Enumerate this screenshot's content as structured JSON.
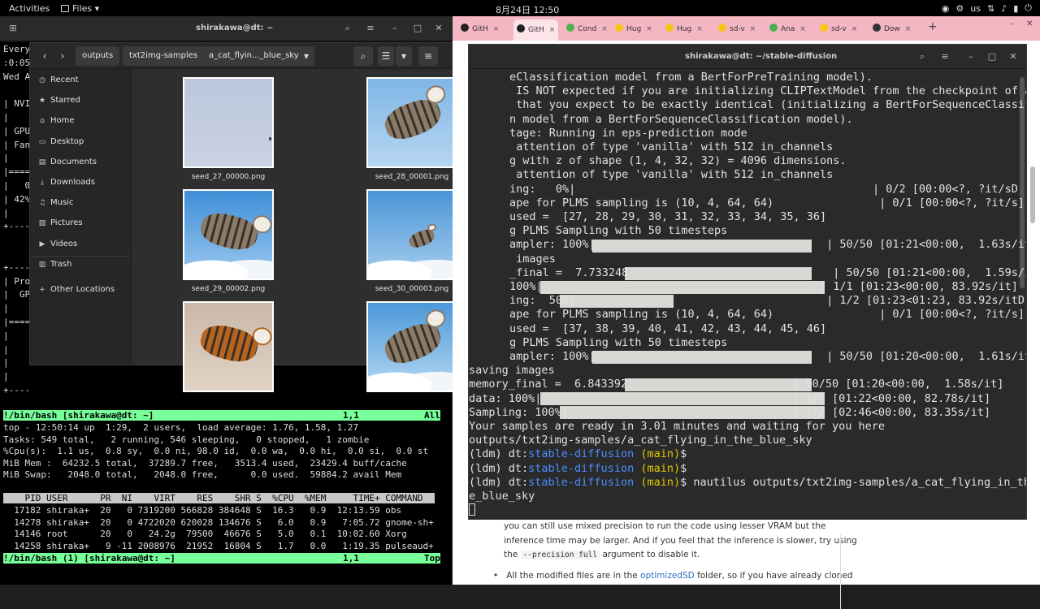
{
  "topbar": {
    "activities": "Activities",
    "files_menu": "Files ▾",
    "clock": "8月24日  12:50",
    "keyboard": "us",
    "tray_icons": [
      "chrome-icon",
      "settings-icon",
      "keyboard-layout",
      "network-icon",
      "volume-icon",
      "battery-icon",
      "power-icon"
    ]
  },
  "left_terminal": {
    "title": "shirakawa@dt: ~",
    "lines": [
      "Every",
      ":0:05",
      "Wed A",
      "",
      "| NVI",
      "|",
      "| GPU",
      "| Fan",
      "|",
      "|====",
      "|   0",
      "| 42%",
      "|",
      "+----",
      "",
      "",
      "+----",
      "| Pro",
      "|  GP",
      "|",
      "|====",
      "|",
      "|",
      "|",
      "|",
      "+----"
    ],
    "vim_status_top": {
      "left": "!/bin/bash [shirakawa@dt: ~]",
      "pos": "1,1",
      "scroll": "All"
    },
    "top_output": [
      "top - 12:50:14 up  1:29,  2 users,  load average: 1.76, 1.58, 1.27",
      "Tasks: 549 total,   2 running, 546 sleeping,   0 stopped,   1 zombie",
      "%Cpu(s):  1.1 us,  0.8 sy,  0.0 ni, 98.0 id,  0.0 wa,  0.0 hi,  0.0 si,  0.0 st",
      "MiB Mem :  64232.5 total,  37289.7 free,   3513.4 used,  23429.4 buff/cache",
      "MiB Swap:   2048.0 total,   2048.0 free,      0.0 used.  59884.2 avail Mem"
    ],
    "process_header": "    PID USER      PR  NI    VIRT    RES    SHR S  %CPU  %MEM     TIME+ COMMAND",
    "processes": [
      "  17182 shiraka+  20   0 7319200 566828 384648 S  16.3   0.9  12:13.59 obs",
      "  14278 shiraka+  20   0 4722020 620028 134676 S   6.0   0.9   7:05.72 gnome-sh+",
      "  14146 root      20   0   24.2g  79500  46676 S   5.0   0.1  10:02.60 Xorg",
      "  14258 shiraka+   9 -11 2008976  21952  16804 S   1.7   0.0   1:19.35 pulseaud+"
    ],
    "vim_status_bottom": {
      "left": "!/bin/bash (1) [shirakawa@dt: ~]",
      "pos": "1,1",
      "scroll": "Top"
    }
  },
  "file_manager": {
    "breadcrumbs": [
      "outputs",
      "txt2img-samples",
      "a_cat_flyin..._blue_sky"
    ],
    "sidebar": [
      "Recent",
      "Starred",
      "Home",
      "Desktop",
      "Documents",
      "Downloads",
      "Music",
      "Pictures",
      "Videos",
      "Trash",
      "Other Locations"
    ],
    "sidebar_icons": [
      "clock-icon",
      "star-icon",
      "home-icon",
      "desktop-icon",
      "document-icon",
      "download-icon",
      "music-icon",
      "pictures-icon",
      "videos-icon",
      "trash-icon",
      "plus-icon"
    ],
    "files": [
      "seed_27_00000.png",
      "seed_28_00001.png",
      "seed_29_00002.png",
      "seed_30_00003.png",
      "",
      ""
    ]
  },
  "browser": {
    "tabs": [
      "GitH",
      "GitH",
      "Cond",
      "Hug",
      "Hug",
      "sd-v",
      "Ana",
      "sd-v",
      "Dow"
    ],
    "tab_colors": [
      "#222222",
      "#222222",
      "#4caf50",
      "#f5c518",
      "#f5c518",
      "#f5c518",
      "#4caf50",
      "#f5c518",
      "#333333"
    ],
    "doc_line1": "you can still use mixed precision to run the code using lesser VRAM but the",
    "doc_line2": "inference time may be larger. And if you feel that the inference is slower, try using",
    "doc_line3_pre": "the",
    "doc_code": "--precision full",
    "doc_line3_post": "argument to disable it.",
    "doc_bullet_pre": "All the modified files are in the",
    "doc_link": "optimizedSD",
    "doc_bullet_post": "folder, so if you have already cloned"
  },
  "right_terminal": {
    "title": "shirakawa@dt: ~/stable-diffusion",
    "lines": [
      "eClassification model from a BertForPreTraining model).",
      " IS NOT expected if you are initializing CLIPTextModel from the checkpoint of a",
      " that you expect to be exactly identical (initializing a BertForSequenceClassif",
      "n model from a BertForSequenceClassification model).",
      "tage: Running in eps-prediction mode",
      " attention of type 'vanilla' with 512 in_channels",
      "g with z of shape (1, 4, 32, 32) = 4096 dimensions.",
      " attention of type 'vanilla' with 512 in_channels",
      "ing:   0%|                                             | 0/2 [00:00<?, ?it/sD",
      "ape for PLMS sampling is (10, 4, 64, 64)                | 0/1 [00:00<?, ?it/s]",
      "used =  [27, 28, 29, 30, 31, 32, 33, 34, 35, 36]",
      "g PLMS Sampling with 50 timesteps",
      "ampler: 100%|                                   | 50/50 [01:21<00:00,  1.63s/it]",
      " images",
      "_final =  7.733248                               | 50/50 [01:21<00:00,  1.59s/it]",
      "100%|                                          | 1/1 [01:23<00:00, 83.92s/it]",
      "ing:  50%|                                      | 1/2 [01:23<01:23, 83.92s/itD",
      "ape for PLMS sampling is (10, 4, 64, 64)                | 0/1 [00:00<?, ?it/s]",
      "used =  [37, 38, 39, 40, 41, 42, 43, 44, 45, 46]",
      "g PLMS Sampling with 50 timesteps",
      "ampler: 100%|                                   | 50/50 [01:20<00:00,  1.61s/it]",
      "saving images",
      "memory_final =  6.843392                         | 50/50 [01:20<00:00,  1.58s/it]",
      "data: 100%|                                      | 1/1 [01:22<00:00, 82.78s/it]",
      "Sampling: 100%|                                  | 2/2 [02:46<00:00, 83.35s/it]",
      "Your samples are ready in 3.01 minutes and waiting for you here",
      "outputs/txt2img-samples/a_cat_flying_in_the_blue_sky"
    ],
    "prompt_env": "(ldm) dt:",
    "prompt_dir": "stable-diffusion",
    "prompt_branch": "(main)",
    "prompt_sym": "$",
    "command": " nautilus outputs/txt2img-samples/a_cat_flying_in_th",
    "command_wrap": "e_blue_sky"
  }
}
